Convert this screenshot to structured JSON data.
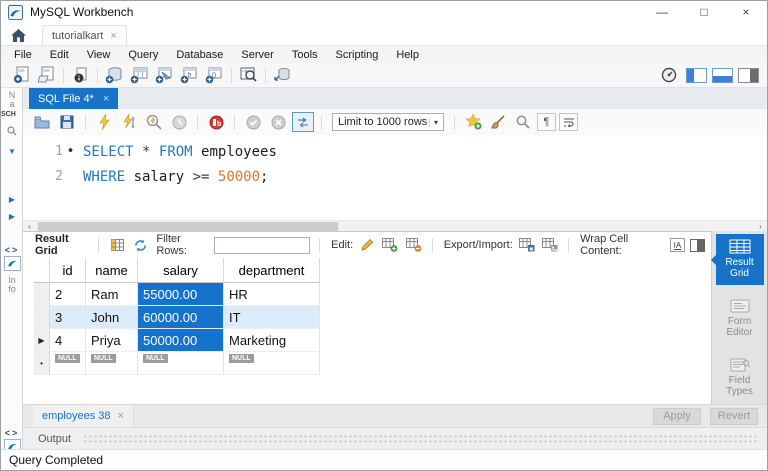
{
  "window": {
    "title": "MySQL Workbench",
    "controls": {
      "minimize": "—",
      "maximize": "□",
      "close": "×"
    }
  },
  "connection_tab": {
    "label": "tutorialkart",
    "close": "×"
  },
  "menu": {
    "items": [
      "File",
      "Edit",
      "View",
      "Query",
      "Database",
      "Server",
      "Tools",
      "Scripting",
      "Help"
    ]
  },
  "editor_tab": {
    "label": "SQL File 4*",
    "close": "×"
  },
  "editor_toolbar": {
    "limit_label": "Limit to 1000 rows",
    "caret": "▾"
  },
  "sql": {
    "lines": [
      {
        "number": "1",
        "marker": "•",
        "tokens": [
          {
            "text": "SELECT",
            "type": "keyword"
          },
          {
            "text": " ",
            "type": "plain"
          },
          {
            "text": "*",
            "type": "operator"
          },
          {
            "text": " ",
            "type": "plain"
          },
          {
            "text": "FROM",
            "type": "keyword"
          },
          {
            "text": " employees",
            "type": "plain"
          }
        ]
      },
      {
        "number": "2",
        "marker": "",
        "tokens": [
          {
            "text": "WHERE",
            "type": "keyword"
          },
          {
            "text": " salary ",
            "type": "plain"
          },
          {
            "text": ">=",
            "type": "operator"
          },
          {
            "text": " ",
            "type": "plain"
          },
          {
            "text": "50000",
            "type": "number"
          },
          {
            "text": ";",
            "type": "plain"
          }
        ]
      }
    ]
  },
  "scrollbar": {
    "left_arrow": "‹",
    "right_arrow": "›"
  },
  "result_toolbar": {
    "title": "Result Grid",
    "filter_label": "Filter Rows:",
    "filter_value": "",
    "edit_label": "Edit:",
    "export_label": "Export/Import:",
    "wrap_label": "Wrap Cell Content:",
    "wrap_icon_text": "IA"
  },
  "grid": {
    "columns": [
      "id",
      "name",
      "salary",
      "department"
    ],
    "selected_column": "salary",
    "rows": [
      [
        "2",
        "Ram",
        "55000.00",
        "HR"
      ],
      [
        "3",
        "John",
        "60000.00",
        "IT"
      ],
      [
        "4",
        "Priya",
        "50000.00",
        "Marketing"
      ]
    ],
    "row_markers": [
      "",
      "",
      "▶"
    ],
    "new_row_marker": "•",
    "null_placeholder": "NULL"
  },
  "side_panel": {
    "tabs": [
      {
        "label": "Result Grid",
        "active": true
      },
      {
        "label": "Form Editor",
        "active": false
      },
      {
        "label": "Field Types",
        "active": false
      }
    ]
  },
  "result_tabs": {
    "tab_label": "employees 38",
    "close": "×",
    "apply_label": "Apply",
    "revert_label": "Revert"
  },
  "output": {
    "label": "Output"
  },
  "status": {
    "text": "Query Completed"
  },
  "left_rail": {
    "navigator": "Na",
    "schemas": "SCH",
    "info": "Info",
    "collapse_arrows": "<>"
  },
  "colors": {
    "accent_blue": "#1673c8",
    "selection_blue": "#1673cd",
    "keyword_blue": "#2478be",
    "number_orange": "#d9782d",
    "alt_row_blue": "#dcebfa",
    "null_badge_gray": "#9c9c9c"
  }
}
